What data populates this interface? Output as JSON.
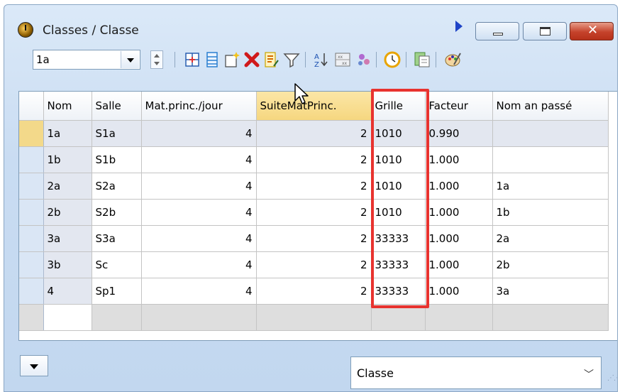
{
  "window": {
    "title": "Classes / Classe"
  },
  "toolbar": {
    "class_selector_value": "1a",
    "icons": [
      "spin-icon",
      "grid-settings-icon",
      "list-icon",
      "new-icon",
      "delete-icon",
      "edit-icon",
      "filter-icon",
      "sort-icon",
      "matrix-icon",
      "users-icon",
      "clock-icon",
      "report-icon",
      "palette-icon"
    ]
  },
  "table": {
    "columns": [
      "Nom",
      "Salle",
      "Mat.princ./jour",
      "SuiteMatPrinc.",
      "Grille",
      "Facteur",
      "Nom an passé"
    ],
    "highlighted_column": "SuiteMatPrinc.",
    "rows": [
      {
        "nom": "1a",
        "salle": "S1a",
        "mat": "4",
        "suite": "2",
        "grille": "1010",
        "facteur": "0.990",
        "prev": ""
      },
      {
        "nom": "1b",
        "salle": "S1b",
        "mat": "4",
        "suite": "2",
        "grille": "1010",
        "facteur": "1.000",
        "prev": ""
      },
      {
        "nom": "2a",
        "salle": "S2a",
        "mat": "4",
        "suite": "2",
        "grille": "1010",
        "facteur": "1.000",
        "prev": "1a"
      },
      {
        "nom": "2b",
        "salle": "S2b",
        "mat": "4",
        "suite": "2",
        "grille": "1010",
        "facteur": "1.000",
        "prev": "1b"
      },
      {
        "nom": "3a",
        "salle": "S3a",
        "mat": "4",
        "suite": "2",
        "grille": "33333",
        "facteur": "1.000",
        "prev": "2a"
      },
      {
        "nom": "3b",
        "salle": "Sc",
        "mat": "4",
        "suite": "2",
        "grille": "33333",
        "facteur": "1.000",
        "prev": "2b"
      },
      {
        "nom": "4",
        "salle": "Sp1",
        "mat": "4",
        "suite": "2",
        "grille": "33333",
        "facteur": "1.000",
        "prev": "3a"
      }
    ]
  },
  "footer": {
    "view_select_value": "Classe"
  },
  "colors": {
    "highlight_box": "#e8332f",
    "header_highlight": "#f6d780",
    "current_row_marker": "#f3d98a"
  }
}
